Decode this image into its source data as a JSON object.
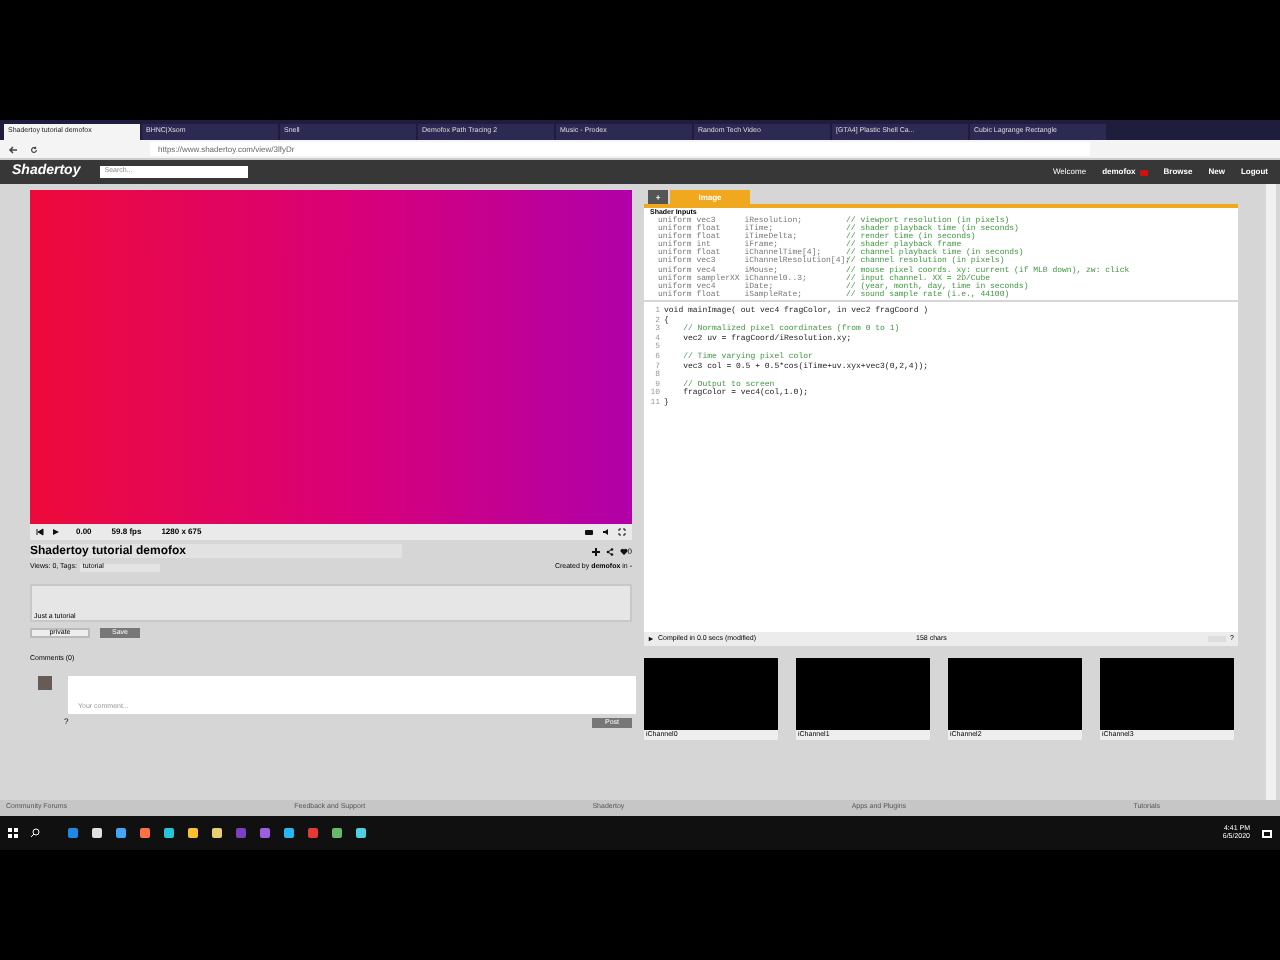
{
  "browser": {
    "tabs": [
      {
        "title": "Shadertoy tutorial demofox",
        "selected": true
      },
      {
        "title": "BHNC|Xsom",
        "selected": false
      },
      {
        "title": "Snell",
        "selected": false
      },
      {
        "title": "Demofox Path Tracing 2",
        "selected": false
      },
      {
        "title": "Music - Prodex",
        "selected": false
      },
      {
        "title": "Random Tech Video",
        "selected": false
      },
      {
        "title": "[GTA4] Plastic Shell Ca...",
        "selected": false
      },
      {
        "title": "Cubic Lagrange Rectangle",
        "selected": false
      }
    ],
    "url": "https://www.shadertoy.com/view/3lfyDr"
  },
  "header": {
    "logo": "Shadertoy",
    "search_placeholder": "Search...",
    "welcome": "Welcome",
    "user": "demofox",
    "nav": [
      "Browse",
      "New",
      "Logout"
    ]
  },
  "player": {
    "time": "0.00",
    "fps": "59.8 fps",
    "resolution": "1280 x 675"
  },
  "shader": {
    "title": "Shadertoy tutorial demofox",
    "views_tags_label": "Views: 0, Tags:",
    "tags": "tutorial",
    "created_by": "Created by",
    "author": "demofox",
    "author_suffix": "in -",
    "likes": "0",
    "description": "Just a tutorial",
    "visibility": "private",
    "save_button": "Save",
    "comments_label": "Comments (0)",
    "comment_placeholder": "Your comment...",
    "help": "?",
    "post_button": "Post"
  },
  "editor": {
    "tabs": [
      {
        "label": "+",
        "selected": false
      },
      {
        "label": "Image",
        "selected": true
      }
    ],
    "inputs_title": "Shader Inputs",
    "inputs": [
      {
        "decl": "uniform vec3      iResolution;",
        "comment": "// viewport resolution (in pixels)"
      },
      {
        "decl": "uniform float     iTime;",
        "comment": "// shader playback time (in seconds)"
      },
      {
        "decl": "uniform float     iTimeDelta;",
        "comment": "// render time (in seconds)"
      },
      {
        "decl": "uniform int       iFrame;",
        "comment": "// shader playback frame"
      },
      {
        "decl": "uniform float     iChannelTime[4];",
        "comment": "// channel playback time (in seconds)"
      },
      {
        "decl": "uniform vec3      iChannelResolution[4];",
        "comment": "// channel resolution (in pixels)"
      },
      {
        "decl": "uniform vec4      iMouse;",
        "comment": "// mouse pixel coords. xy: current (if MLB down), zw: click"
      },
      {
        "decl": "uniform samplerXX iChannel0..3;",
        "comment": "// input channel. XX = 2D/Cube"
      },
      {
        "decl": "uniform vec4      iDate;",
        "comment": "// (year, month, day, time in seconds)"
      },
      {
        "decl": "uniform float     iSampleRate;",
        "comment": "// sound sample rate (i.e., 44100)"
      }
    ],
    "code": [
      {
        "number": "1",
        "kind": "code",
        "text": "void mainImage( out vec4 fragColor, in vec2 fragCoord )"
      },
      {
        "number": "2",
        "kind": "code",
        "text": "{"
      },
      {
        "number": "3",
        "kind": "comment",
        "text": "    // Normalized pixel coordinates (from 0 to 1)"
      },
      {
        "number": "4",
        "kind": "code",
        "text": "    vec2 uv = fragCoord/iResolution.xy;"
      },
      {
        "number": "5",
        "kind": "blank"
      },
      {
        "number": "6",
        "kind": "comment",
        "text": "    // Time varying pixel color"
      },
      {
        "number": "7",
        "kind": "code",
        "text": "    vec3 col = 0.5 + 0.5*cos(iTime+uv.xyx+vec3(0,2,4));"
      },
      {
        "number": "8",
        "kind": "blank"
      },
      {
        "number": "9",
        "kind": "comment",
        "text": "    // Output to screen"
      },
      {
        "number": "10",
        "kind": "code",
        "text": "    fragColor = vec4(col,1.0);"
      },
      {
        "number": "11",
        "kind": "code",
        "text": "}"
      }
    ],
    "status": "Compiled in 0.0 secs (modified)",
    "chars": "158 chars",
    "help": "?"
  },
  "channels": [
    "iChannel0",
    "iChannel1",
    "iChannel2",
    "iChannel3"
  ],
  "footer": [
    "Community Forums",
    "Feedback and Support",
    "Shadertoy",
    "Apps and Plugins",
    "Tutorials"
  ],
  "taskbar": {
    "time": "4:41 PM",
    "date": "6/5/2020"
  }
}
